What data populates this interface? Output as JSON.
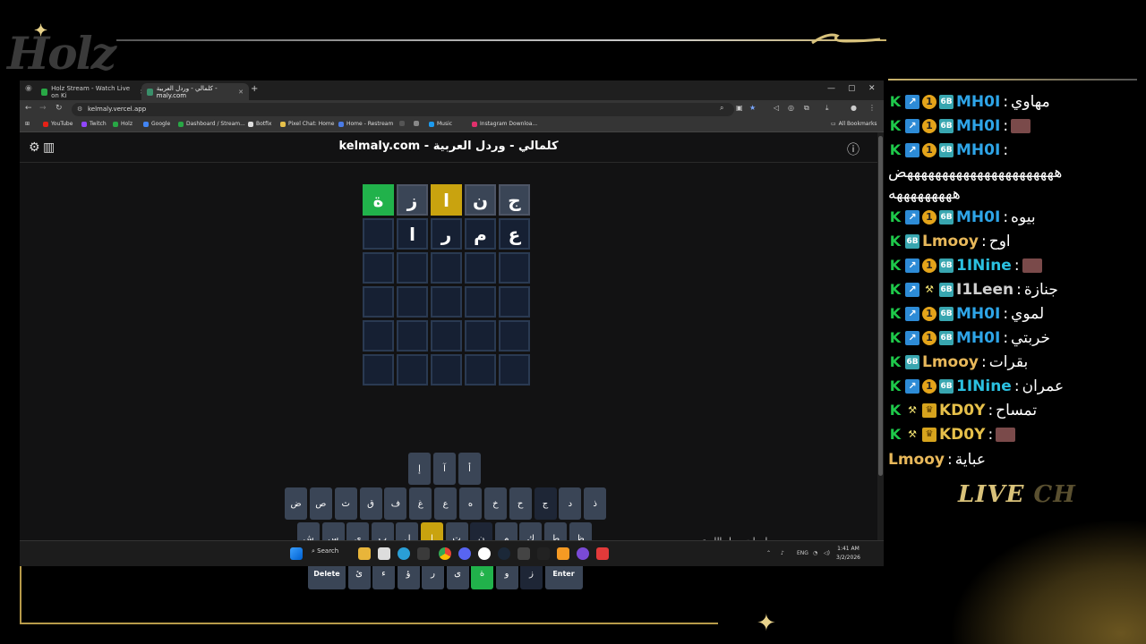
{
  "overlay": {
    "logo_text": "Holz",
    "live_chat_bright": "LIVE",
    "live_chat_faded": "CH"
  },
  "chat": [
    {
      "user": "MH0I",
      "color": "mhoi",
      "badges": [
        "k",
        "arrow",
        "one",
        "sixb"
      ],
      "text": "مهاوي",
      "emote": false
    },
    {
      "user": "MH0I",
      "color": "mhoi",
      "badges": [
        "k",
        "arrow",
        "one",
        "sixb"
      ],
      "text": "",
      "emote": true
    },
    {
      "user": "MH0I",
      "color": "mhoi",
      "badges": [
        "k",
        "arrow",
        "one",
        "sixb"
      ],
      "text": "",
      "emote": false
    },
    {
      "user": "",
      "color": "",
      "badges": [],
      "text": "ههههههههههههههههههههههض",
      "emote": false,
      "plain": true
    },
    {
      "user": "",
      "color": "",
      "badges": [],
      "text": "هههههههههه",
      "emote": false,
      "plain": true
    },
    {
      "user": "MH0I",
      "color": "mhoi",
      "badges": [
        "k",
        "arrow",
        "one",
        "sixb"
      ],
      "text": "بيوه",
      "emote": false
    },
    {
      "user": "Lmooy",
      "color": "lmooy",
      "badges": [
        "k",
        "sixb"
      ],
      "text": "اوح",
      "emote": false
    },
    {
      "user": "1INine",
      "color": "nine",
      "badges": [
        "k",
        "arrow",
        "one",
        "sixb"
      ],
      "text": "",
      "emote": true
    },
    {
      "user": "I1Leen",
      "color": "leen",
      "badges": [
        "k",
        "arrow",
        "ax",
        "sixb"
      ],
      "text": "جنازة",
      "emote": false
    },
    {
      "user": "MH0I",
      "color": "mhoi",
      "badges": [
        "k",
        "arrow",
        "one",
        "sixb"
      ],
      "text": "لموي",
      "emote": false
    },
    {
      "user": "MH0I",
      "color": "mhoi",
      "badges": [
        "k",
        "arrow",
        "one",
        "sixb"
      ],
      "text": "خربتي",
      "emote": false
    },
    {
      "user": "Lmooy",
      "color": "lmooy",
      "badges": [
        "k",
        "sixb"
      ],
      "text": "بقرات",
      "emote": false
    },
    {
      "user": "1INine",
      "color": "nine",
      "badges": [
        "k",
        "arrow",
        "one",
        "sixb"
      ],
      "text": "عمران",
      "emote": false
    },
    {
      "user": "KD0Y",
      "color": "kd",
      "badges": [
        "k",
        "ax",
        "crown"
      ],
      "text": "تمساح",
      "emote": false
    },
    {
      "user": "KD0Y",
      "color": "kd",
      "badges": [
        "k",
        "ax",
        "crown"
      ],
      "text": "",
      "emote": true
    },
    {
      "user": "Lmooy",
      "color": "lmooy",
      "badges": [],
      "text": "عباية",
      "emote": false
    }
  ],
  "browser": {
    "tabs": [
      {
        "label": "Holz Stream - Watch Live on Ki"
      },
      {
        "label": "كلمالي - وردل العربية - maly.com"
      }
    ],
    "url": "kelmaly.vercel.app",
    "bookmarks": [
      "YouTube",
      "Twitch",
      "Holz",
      "Google",
      "Dashboard / Stream...",
      "Botfix",
      "Pixel Chat: Home",
      "Home - Restream",
      "Music",
      "Instagram Downloa..."
    ],
    "all_bookmarks": "All Bookmarks"
  },
  "game": {
    "title": "kelmaly.com - كلمالي - وردل العربية",
    "rows": [
      [
        {
          "l": "ج",
          "s": "filled"
        },
        {
          "l": "ن",
          "s": "filled"
        },
        {
          "l": "ا",
          "s": "present"
        },
        {
          "l": "ز",
          "s": "filled"
        },
        {
          "l": "ة",
          "s": "correct"
        }
      ],
      [
        {
          "l": "ع",
          "s": "typing"
        },
        {
          "l": "م",
          "s": "typing"
        },
        {
          "l": "ر",
          "s": "typing"
        },
        {
          "l": "ا",
          "s": "typing"
        },
        {
          "l": "",
          "s": "typing"
        }
      ],
      [
        {
          "l": "",
          "s": "typing"
        },
        {
          "l": "",
          "s": "typing"
        },
        {
          "l": "",
          "s": "typing"
        },
        {
          "l": "",
          "s": "typing"
        },
        {
          "l": "",
          "s": "typing"
        }
      ],
      [
        {
          "l": "",
          "s": "typing"
        },
        {
          "l": "",
          "s": "typing"
        },
        {
          "l": "",
          "s": "typing"
        },
        {
          "l": "",
          "s": "typing"
        },
        {
          "l": "",
          "s": "typing"
        }
      ],
      [
        {
          "l": "",
          "s": "typing"
        },
        {
          "l": "",
          "s": "typing"
        },
        {
          "l": "",
          "s": "typing"
        },
        {
          "l": "",
          "s": "typing"
        },
        {
          "l": "",
          "s": "typing"
        }
      ],
      [
        {
          "l": "",
          "s": "typing"
        },
        {
          "l": "",
          "s": "typing"
        },
        {
          "l": "",
          "s": "typing"
        },
        {
          "l": "",
          "s": "typing"
        },
        {
          "l": "",
          "s": "typing"
        }
      ]
    ],
    "keyboard": {
      "row0": [
        {
          "l": "إ"
        },
        {
          "l": "آ"
        },
        {
          "l": "أ"
        }
      ],
      "row1": [
        {
          "l": "ض"
        },
        {
          "l": "ص"
        },
        {
          "l": "ث"
        },
        {
          "l": "ق"
        },
        {
          "l": "ف"
        },
        {
          "l": "غ"
        },
        {
          "l": "ع"
        },
        {
          "l": "ه"
        },
        {
          "l": "خ"
        },
        {
          "l": "ح"
        },
        {
          "l": "ج",
          "s": "dark"
        },
        {
          "l": "د"
        },
        {
          "l": "ذ"
        }
      ],
      "row2": [
        {
          "l": "ش"
        },
        {
          "l": "س"
        },
        {
          "l": "ي"
        },
        {
          "l": "ب"
        },
        {
          "l": "ل"
        },
        {
          "l": "ا",
          "s": "present"
        },
        {
          "l": "ت"
        },
        {
          "l": "ن",
          "s": "dark"
        },
        {
          "l": "م"
        },
        {
          "l": "ك"
        },
        {
          "l": "ط"
        },
        {
          "l": "ظ"
        }
      ],
      "row3": [
        {
          "l": "Delete",
          "s": "wide"
        },
        {
          "l": "ئ"
        },
        {
          "l": "ء"
        },
        {
          "l": "ؤ"
        },
        {
          "l": "ر"
        },
        {
          "l": "ى"
        },
        {
          "l": "ة",
          "s": "correct"
        },
        {
          "l": "و"
        },
        {
          "l": "ز",
          "s": "dark"
        },
        {
          "l": "Enter",
          "s": "wide"
        }
      ]
    },
    "info_link": "معلومات حول اللعبة"
  },
  "taskbar": {
    "search": "Search",
    "lang": "ENG",
    "time": "1:41 AM",
    "date": "3/2/2026"
  }
}
